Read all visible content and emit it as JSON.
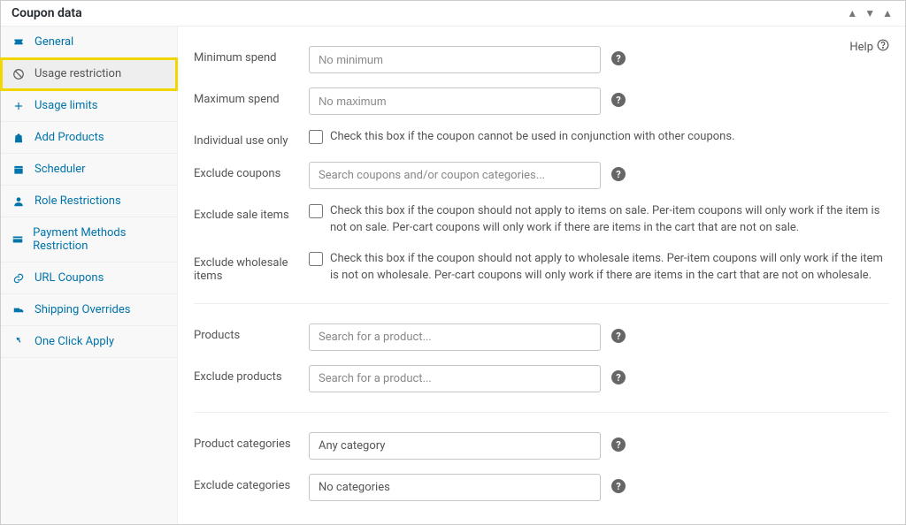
{
  "panel": {
    "title": "Coupon data",
    "help": "Help"
  },
  "sidebar": {
    "items": [
      {
        "label": "General"
      },
      {
        "label": "Usage restriction"
      },
      {
        "label": "Usage limits"
      },
      {
        "label": "Add Products"
      },
      {
        "label": "Scheduler"
      },
      {
        "label": "Role Restrictions"
      },
      {
        "label": "Payment Methods Restriction"
      },
      {
        "label": "URL Coupons"
      },
      {
        "label": "Shipping Overrides"
      },
      {
        "label": "One Click Apply"
      }
    ]
  },
  "labels": {
    "min_spend": "Minimum spend",
    "max_spend": "Maximum spend",
    "individual_use": "Individual use only",
    "exclude_coupons": "Exclude coupons",
    "exclude_sale": "Exclude sale items",
    "exclude_wholesale": "Exclude wholesale items",
    "products": "Products",
    "exclude_products": "Exclude products",
    "product_categories": "Product categories",
    "exclude_categories": "Exclude categories"
  },
  "placeholders": {
    "min_spend": "No minimum",
    "max_spend": "No maximum",
    "exclude_coupons": "Search coupons and/or coupon categories...",
    "products": "Search for a product...",
    "exclude_products": "Search for a product..."
  },
  "display_values": {
    "product_categories": "Any category",
    "exclude_categories": "No categories"
  },
  "checkbox_text": {
    "individual_use": "Check this box if the coupon cannot be used in conjunction with other coupons.",
    "exclude_sale": "Check this box if the coupon should not apply to items on sale. Per-item coupons will only work if the item is not on sale. Per-cart coupons will only work if there are items in the cart that are not on sale.",
    "exclude_wholesale": "Check this box if the coupon should not apply to wholesale items. Per-item coupons will only work if the item is not on wholesale. Per-cart coupons will only work if there are items in the cart that are not on wholesale."
  }
}
